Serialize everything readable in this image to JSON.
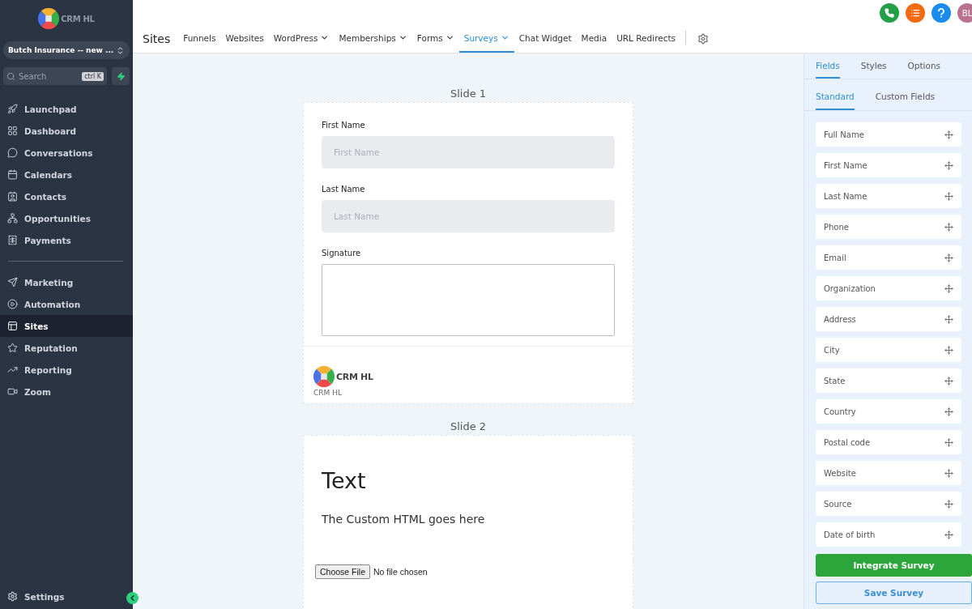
{
  "sidebar": {
    "logo_text": "CRM HL",
    "account": "Butch Insurance -- new ...",
    "search": {
      "placeholder": "Search",
      "shortcut": "ctrl K"
    },
    "groups": [
      [
        {
          "label": "Launchpad",
          "kind": "launchpad",
          "selected": false
        },
        {
          "label": "Dashboard",
          "kind": "dashboard",
          "selected": false
        },
        {
          "label": "Conversations",
          "kind": "conversations",
          "selected": false
        },
        {
          "label": "Calendars",
          "kind": "calendars",
          "selected": false
        },
        {
          "label": "Contacts",
          "kind": "contacts",
          "selected": false
        },
        {
          "label": "Opportunities",
          "kind": "opportunities",
          "selected": false
        },
        {
          "label": "Payments",
          "kind": "payments",
          "selected": false
        }
      ],
      [
        {
          "label": "Marketing",
          "kind": "marketing",
          "selected": false
        },
        {
          "label": "Automation",
          "kind": "automation",
          "selected": false
        },
        {
          "label": "Sites",
          "kind": "sites",
          "selected": true
        },
        {
          "label": "Reputation",
          "kind": "reputation",
          "selected": false
        },
        {
          "label": "Reporting",
          "kind": "reporting",
          "selected": false
        },
        {
          "label": "Zoom",
          "kind": "zoom",
          "selected": false
        }
      ]
    ],
    "settings": "Settings"
  },
  "header": {
    "title": "Sites",
    "tabs": [
      {
        "label": "Funnels",
        "dropdown": false,
        "selected": false
      },
      {
        "label": "Websites",
        "dropdown": false,
        "selected": false
      },
      {
        "label": "WordPress",
        "dropdown": true,
        "selected": false
      },
      {
        "label": "Memberships",
        "dropdown": true,
        "selected": false
      },
      {
        "label": "Forms",
        "dropdown": true,
        "selected": false
      },
      {
        "label": "Surveys",
        "dropdown": true,
        "selected": true
      },
      {
        "label": "Chat Widget",
        "dropdown": false,
        "selected": false
      },
      {
        "label": "Media",
        "dropdown": false,
        "selected": false
      },
      {
        "label": "URL Redirects",
        "dropdown": false,
        "selected": false
      }
    ],
    "actions": [
      {
        "kind": "phone",
        "color": "#23a047"
      },
      {
        "kind": "list",
        "color": "#f46a0f"
      },
      {
        "kind": "help",
        "color": "#1a8cf0"
      }
    ],
    "avatar": {
      "initials": "BL",
      "color": "#b9738f"
    }
  },
  "canvas": {
    "slides": [
      {
        "title": "Slide 1",
        "elements": [
          {
            "kind": "input",
            "label": "First Name",
            "placeholder": "First Name"
          },
          {
            "kind": "input",
            "label": "Last Name",
            "placeholder": "Last Name"
          },
          {
            "kind": "signature",
            "label": "Signature"
          },
          {
            "kind": "logo",
            "logo_text": "CRM HL",
            "caption": "CRM HL"
          }
        ]
      },
      {
        "title": "Slide 2",
        "elements": [
          {
            "kind": "heading",
            "text": "Text"
          },
          {
            "kind": "paragraph",
            "text": "The Custom HTML goes here"
          },
          {
            "kind": "file",
            "button": "Choose File",
            "status": "No file chosen"
          }
        ]
      }
    ]
  },
  "panel": {
    "tabs": [
      {
        "label": "Fields",
        "selected": true
      },
      {
        "label": "Styles",
        "selected": false
      },
      {
        "label": "Options",
        "selected": false
      }
    ],
    "subtabs": [
      {
        "label": "Standard",
        "selected": true
      },
      {
        "label": "Custom Fields",
        "selected": false
      }
    ],
    "fields": [
      "Full Name",
      "First Name",
      "Last Name",
      "Phone",
      "Email",
      "Organization",
      "Address",
      "City",
      "State",
      "Country",
      "Postal code",
      "Website",
      "Source",
      "Date of birth"
    ],
    "buttons": [
      {
        "label": "Integrate Survey",
        "kind": "primary"
      },
      {
        "label": "Save Survey",
        "kind": "secondary"
      }
    ]
  }
}
